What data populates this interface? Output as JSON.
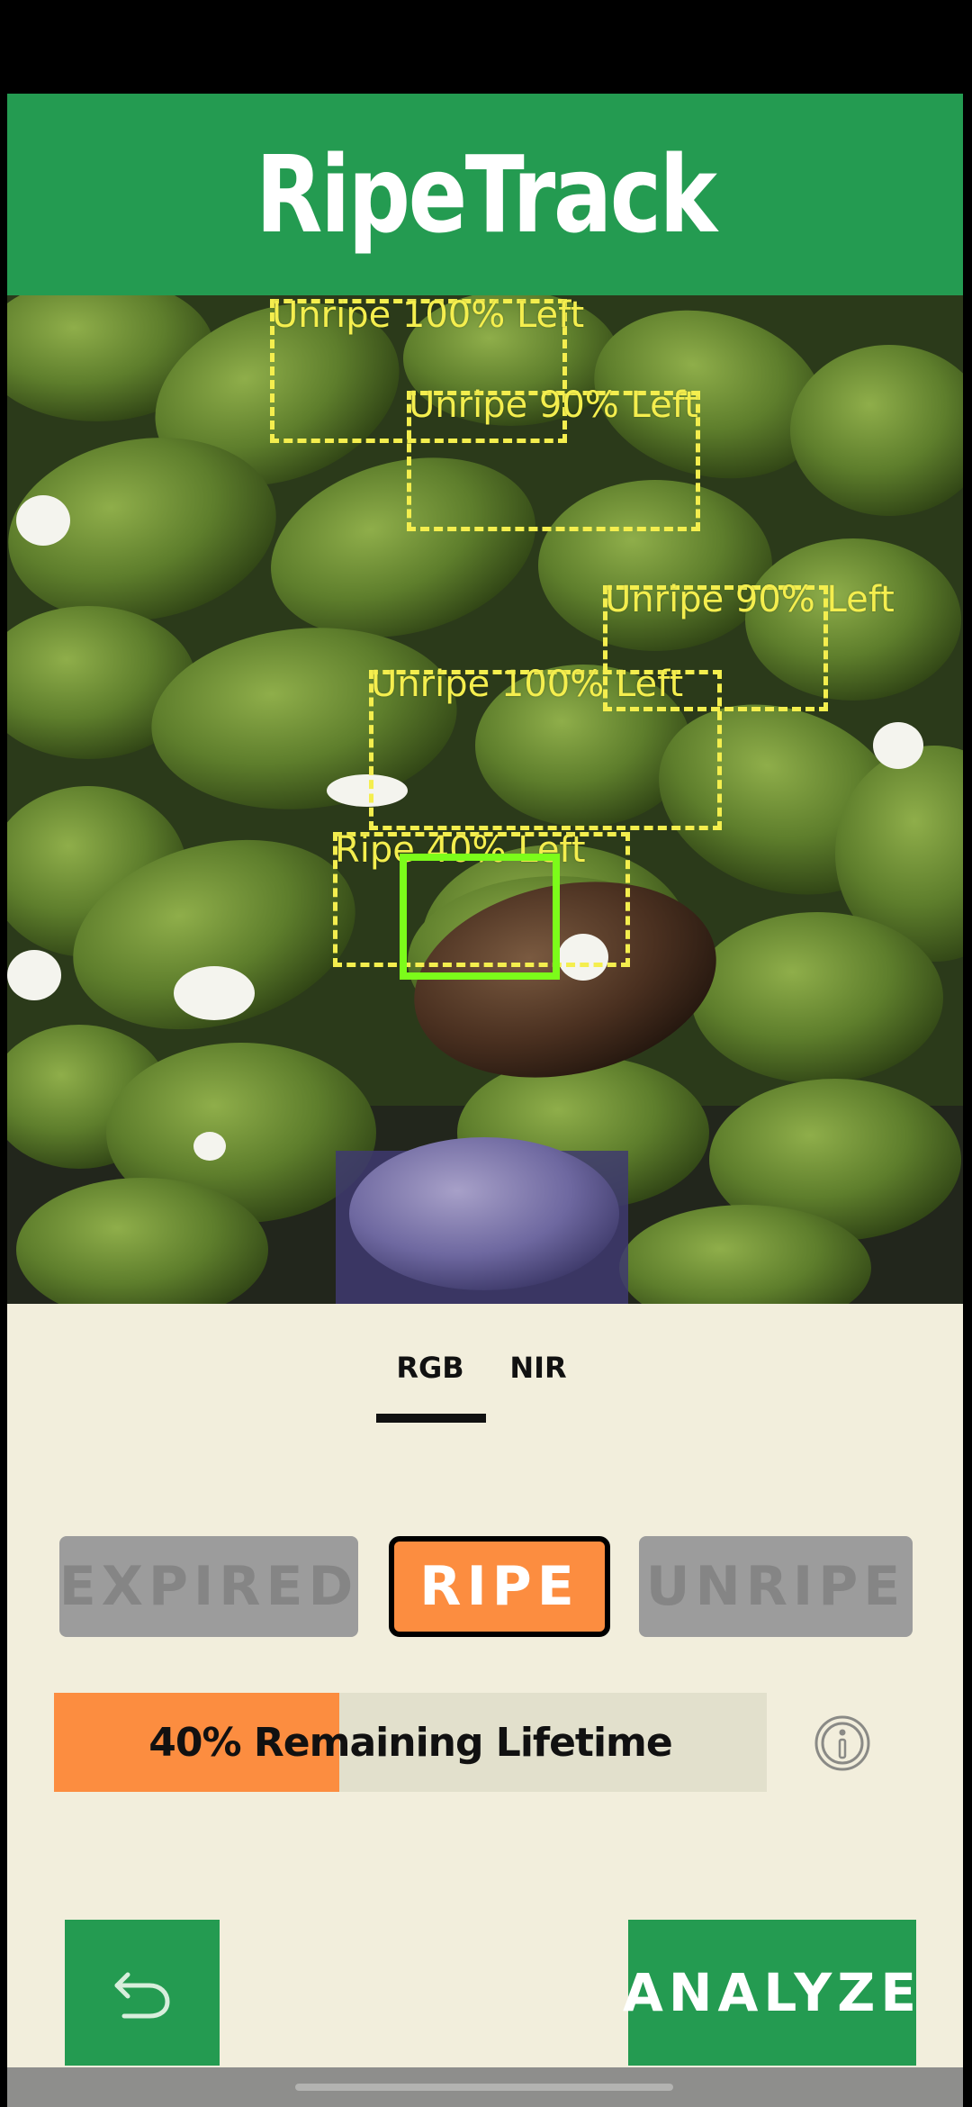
{
  "app": {
    "title": "RipeTrack"
  },
  "colors": {
    "header_green": "#249B51",
    "accent_orange": "#FC8D40",
    "background_cream": "#F2EEDC",
    "inactive_gray": "#9C9C9C",
    "detection_yellow": "#F4EE4E",
    "roi_green": "#7CFC1A"
  },
  "detections": [
    {
      "label": "Unripe 100% Left"
    },
    {
      "label": "Unripe 90% Left"
    },
    {
      "label": "Unripe 90% Left"
    },
    {
      "label": "Unripe 100% Left"
    },
    {
      "label": "Ripe 40% Left"
    }
  ],
  "tabs": [
    {
      "label": "RGB",
      "selected": true
    },
    {
      "label": "NIR",
      "selected": false
    }
  ],
  "status_buttons": [
    {
      "label": "EXPIRED",
      "active": false
    },
    {
      "label": "RIPE",
      "active": true
    },
    {
      "label": "UNRIPE",
      "active": false
    }
  ],
  "lifetime": {
    "label": "40% Remaining Lifetime",
    "fraction": 0.4
  },
  "icons": {
    "info": "info-icon",
    "back": "undo-arrow-icon"
  },
  "actions": {
    "analyze_label": "ANALYZE"
  }
}
